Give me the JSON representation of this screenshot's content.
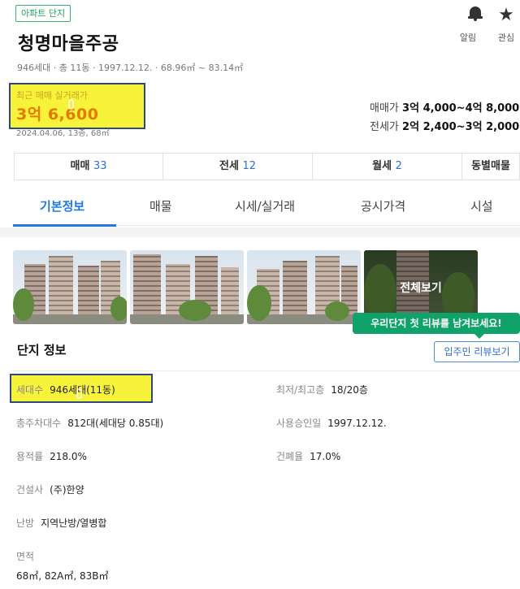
{
  "header": {
    "tag": "아파트 단지",
    "name": "청명마을주공",
    "summary": "946세대 · 총 11동 · 1997.12.12. · 68.96㎡ ~ 83.14㎡",
    "actions": [
      {
        "icon": "bell-icon",
        "label": "알림"
      },
      {
        "icon": "star-icon",
        "label": "관심"
      }
    ]
  },
  "recent_trade": {
    "label": "최근 매매 실거래가",
    "price": "3억 6,600",
    "date": "2024.04.06, 13층, 68㎡"
  },
  "price_ranges": [
    {
      "label": "매매가",
      "value": "3억 4,000~4억 8,000"
    },
    {
      "label": "전세가",
      "value": "2억 2,400~3억 2,000"
    }
  ],
  "deal_tabs": [
    {
      "label": "매매",
      "count": "33"
    },
    {
      "label": "전세",
      "count": "12"
    },
    {
      "label": "월세",
      "count": "2"
    },
    {
      "label": "동별매물",
      "count": ""
    }
  ],
  "main_tabs": [
    "기본정보",
    "매물",
    "시세/실거래",
    "공시가격",
    "시설"
  ],
  "photos": {
    "all_label": "전체보기"
  },
  "review_banner": "우리단지 첫 리뷰를 남겨보세요!",
  "complex_info": {
    "title": "단지 정보",
    "resident_review_button": "입주민 리뷰보기",
    "rows": [
      {
        "key": "세대수",
        "value": "946세대(11동)"
      },
      {
        "key": "최저/최고층",
        "value": "18/20층"
      },
      {
        "key": "총주차대수",
        "value": "812대(세대당 0.85대)"
      },
      {
        "key": "사용승인일",
        "value": "1997.12.12."
      },
      {
        "key": "용적률",
        "value": "218.0%"
      },
      {
        "key": "건폐율",
        "value": "17.0%"
      },
      {
        "key": "건설사",
        "value": "(주)한양"
      },
      {
        "key": "난방",
        "value": "지역난방/열병합"
      },
      {
        "key": "면적",
        "value": "68㎡, 82A㎡, 83B㎡"
      }
    ]
  },
  "colors": {
    "accent_blue": "#1f7ae0",
    "tag_green": "#1fa35a",
    "banner_green": "#0fa36a",
    "highlight_yellow": "#f7f23a",
    "price_orange": "#e57a00"
  }
}
